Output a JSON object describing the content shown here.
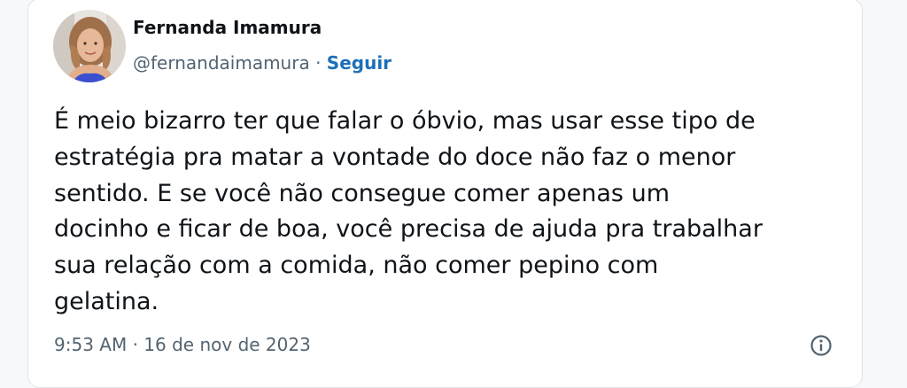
{
  "tweet": {
    "author": {
      "display_name": "Fernanda Imamura",
      "handle": "@fernandaimamura",
      "separator": " · ",
      "follow_label": "Seguir"
    },
    "text": "É meio bizarro ter que falar o óbvio, mas usar esse tipo de\nestratégia pra matar a vontade do doce não faz o menor\nsentido. E se você não consegue comer apenas um\ndocinho e ficar de boa, você precisa de ajuda pra trabalhar\nsua relação com a comida, não comer pepino com\ngelatina.",
    "time": "9:53 AM",
    "date_separator": " · ",
    "date": "16 de nov de 2023",
    "icons": {
      "avatar": "avatar-photo",
      "info": "info-icon"
    }
  },
  "colors": {
    "text": "#0f1419",
    "secondary": "#536471",
    "link": "#1d6fb8",
    "background": "#f7f8f9",
    "card": "#ffffff"
  }
}
